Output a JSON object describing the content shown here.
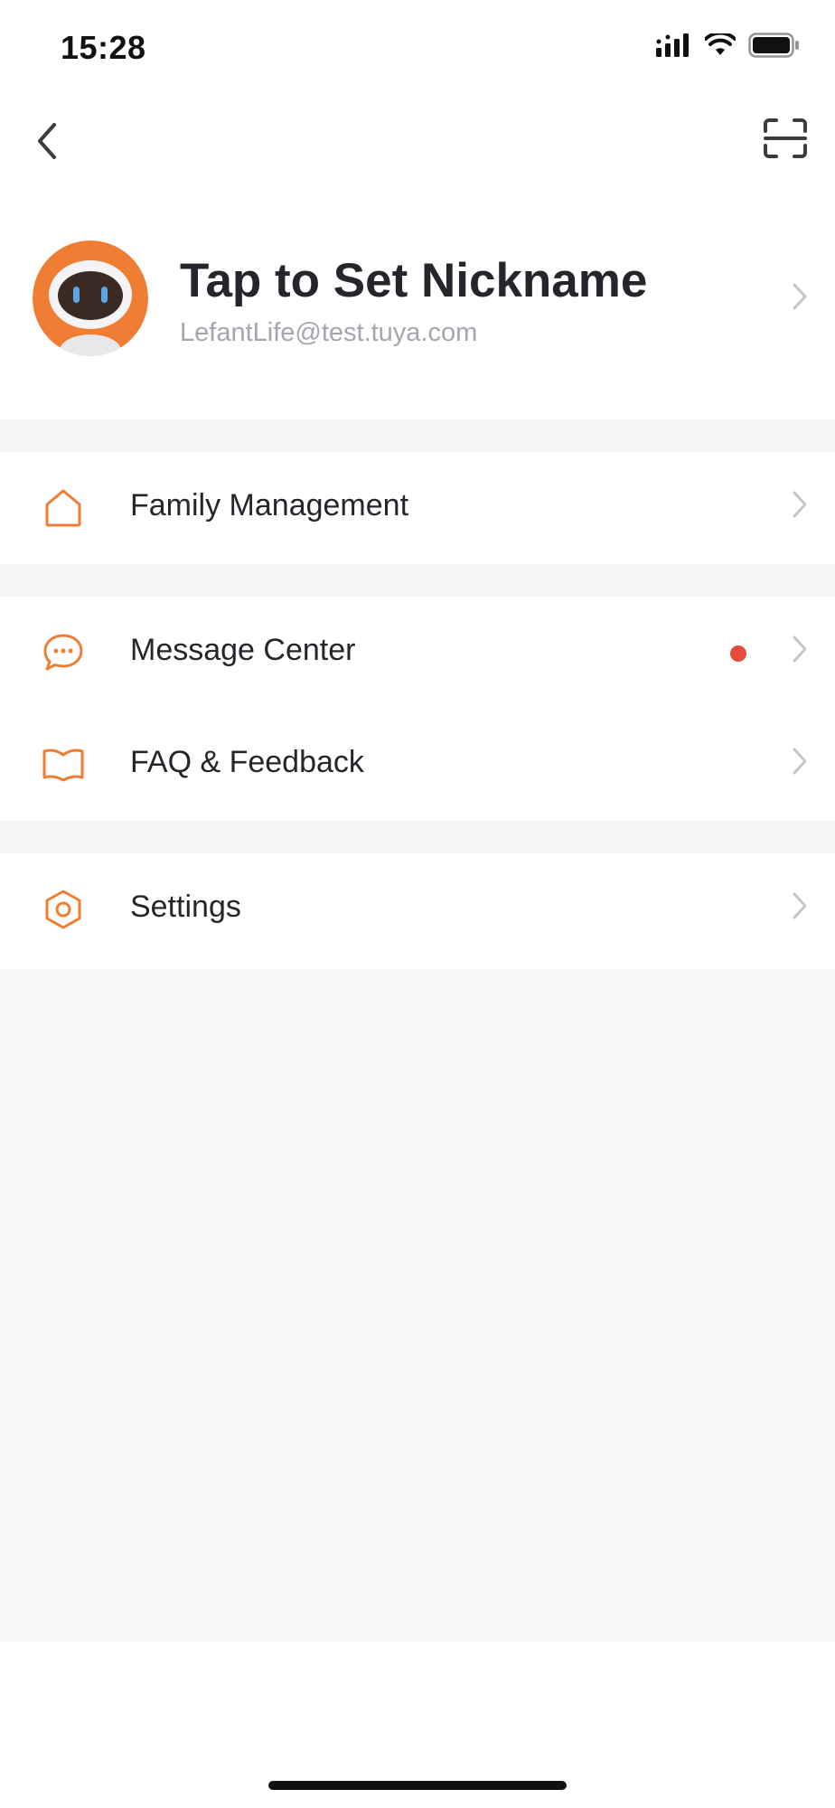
{
  "status_bar": {
    "time": "15:28",
    "icons": [
      "cellular-signal-icon",
      "wifi-icon",
      "battery-icon"
    ]
  },
  "nav": {
    "back_icon": "chevron-left-icon",
    "scan_icon": "scan-icon"
  },
  "profile": {
    "nickname": "Tap to Set Nickname",
    "email": "LefantLife@test.tuya.com",
    "avatar": "robot-avatar"
  },
  "menu": {
    "family_management": {
      "label": "Family Management",
      "icon": "home-icon"
    },
    "message_center": {
      "label": "Message Center",
      "icon": "chat-bubble-icon",
      "has_unread": true
    },
    "faq_feedback": {
      "label": "FAQ & Feedback",
      "icon": "book-icon"
    },
    "settings": {
      "label": "Settings",
      "icon": "hexagon-gear-icon"
    }
  },
  "colors": {
    "accent": "#f07d34",
    "badge": "#e64b3b",
    "chevron": "#c4c6cc",
    "separator": "#f6f6f6",
    "primary_text": "#24262b",
    "secondary_text": "#a3a6ad"
  }
}
